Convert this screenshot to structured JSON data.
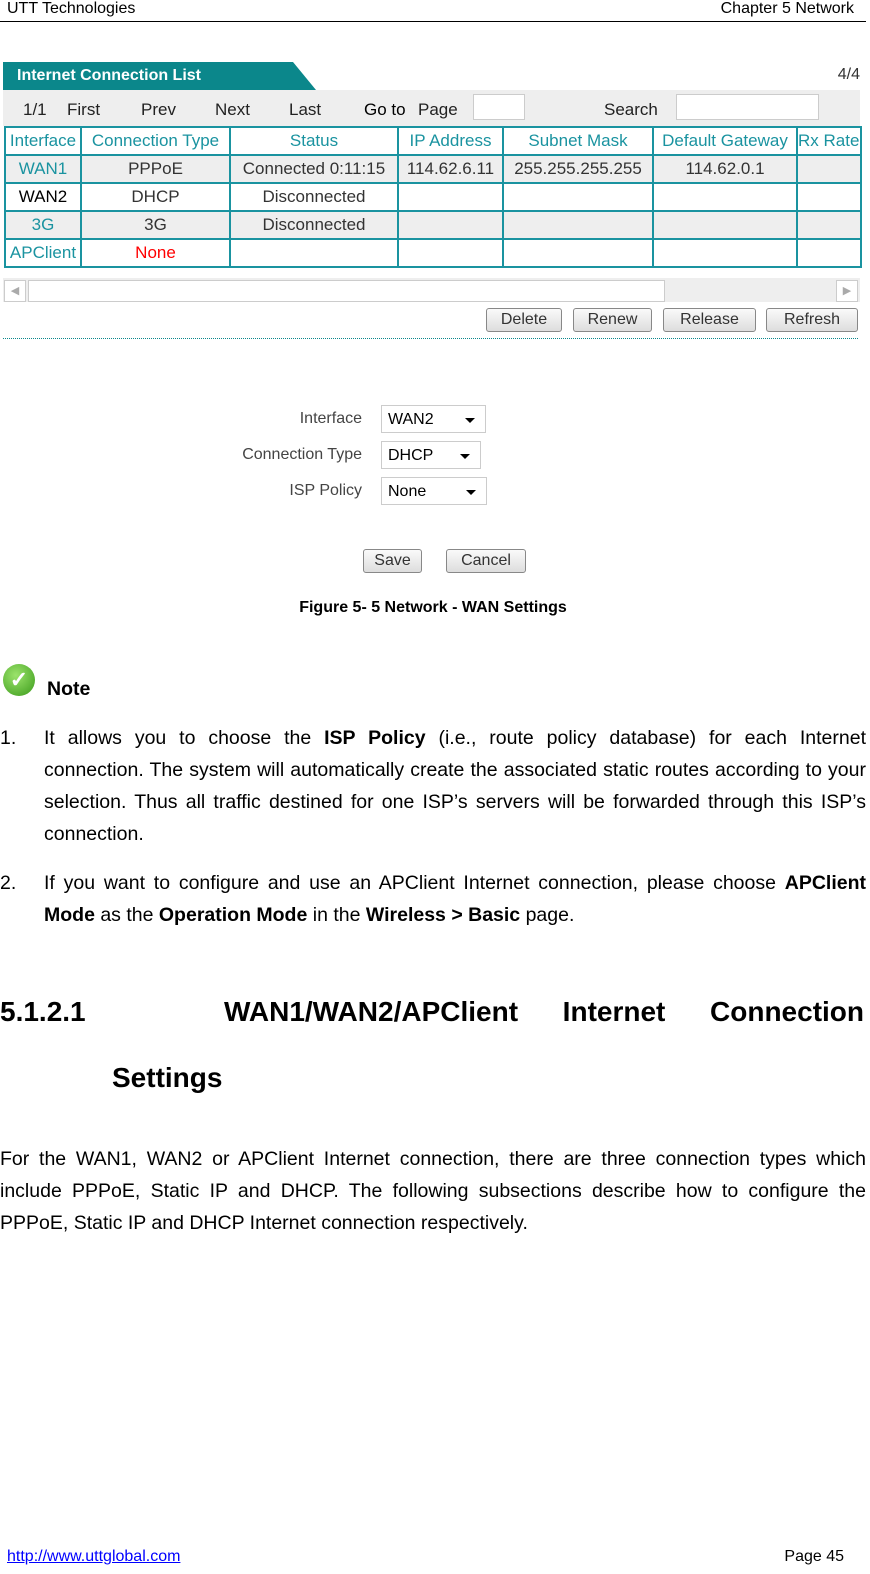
{
  "header": {
    "left": "UTT Technologies",
    "right": "Chapter 5 Network"
  },
  "list": {
    "title": "Internet Connection List",
    "count": "4/4",
    "nav": {
      "page": "1/1",
      "first": "First",
      "prev": "Prev",
      "next": "Next",
      "last": "Last",
      "goto": "Go to",
      "page_label": "Page",
      "search": "Search"
    },
    "columns": [
      "Interface",
      "Connection Type",
      "Status",
      "IP Address",
      "Subnet Mask",
      "Default Gateway",
      "Rx Rate"
    ],
    "rows": [
      {
        "interface": "WAN1",
        "type": "PPPoE",
        "status": "Connected 0:11:15",
        "ip": "114.62.6.11",
        "mask": "255.255.255.255",
        "gateway": "114.62.0.1"
      },
      {
        "interface": "WAN2",
        "type": "DHCP",
        "status": "Disconnected",
        "ip": "",
        "mask": "",
        "gateway": ""
      },
      {
        "interface": "3G",
        "type": "3G",
        "status": "Disconnected",
        "ip": "",
        "mask": "",
        "gateway": ""
      },
      {
        "interface": "APClient",
        "type": "None",
        "status": "",
        "ip": "",
        "mask": "",
        "gateway": ""
      }
    ],
    "buttons": {
      "delete": "Delete",
      "renew": "Renew",
      "release": "Release",
      "refresh": "Refresh"
    }
  },
  "form": {
    "interface_label": "Interface",
    "interface_value": "WAN2",
    "type_label": "Connection Type",
    "type_value": "DHCP",
    "isp_label": "ISP Policy",
    "isp_value": "None",
    "save": "Save",
    "cancel": "Cancel"
  },
  "caption": "Figure 5- 5 Network - WAN Settings",
  "note": {
    "title": "Note",
    "item1": {
      "num": "1.",
      "a": "It allows you to choose the ",
      "b": "ISP Policy",
      "c": " (i.e., route policy database) for each Internet connection. The system will automatically create the associated static routes according to your selection. Thus all traffic destined for one ISP’s servers will be forwarded through this ISP’s connection."
    },
    "item2": {
      "num": "2.",
      "a": "If you want to configure and use an APClient Internet connection, please choose ",
      "b": "APClient Mode",
      "c": " as the ",
      "d": "Operation Mode",
      "e": " in the ",
      "f": "Wireless > Basic",
      "g": " page."
    }
  },
  "section": {
    "number": "5.1.2.1",
    "title": "WAN1/WAN2/APClient Internet Connection",
    "title2": "Settings"
  },
  "paragraph": "For the WAN1, WAN2 or APClient Internet connection, there are three connection types which include PPPoE, Static IP and DHCP. The following subsections describe how to configure the PPPoE, Static IP and DHCP Internet connection respectively.",
  "footer": {
    "url": "http://www.uttglobal.com",
    "page": "Page 45"
  },
  "colors": {
    "teal": "#0b878b",
    "red": "#ff0000"
  }
}
